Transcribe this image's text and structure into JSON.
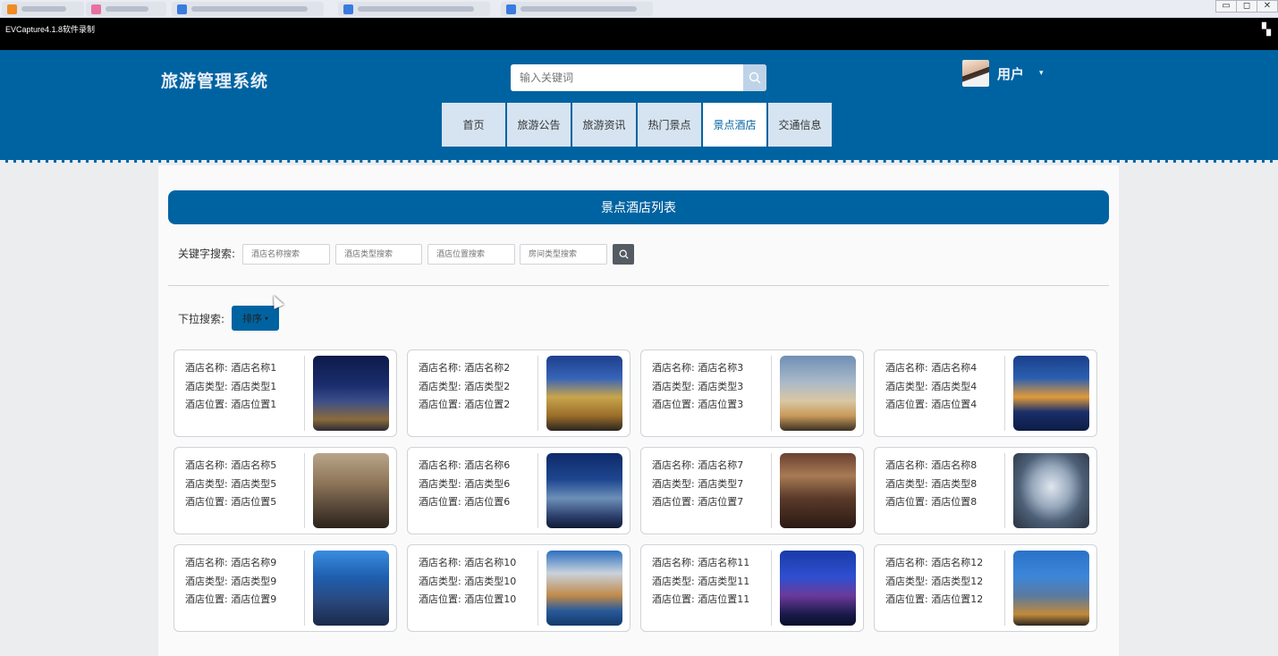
{
  "os": {
    "window_controls": [
      "▭",
      "◻",
      "✕"
    ]
  },
  "capture": {
    "title": "EVCapture4.1.8软件录制",
    "menu_icon": "grid-menu-icon"
  },
  "header": {
    "site_title": "旅游管理系统",
    "search_placeholder": "输入关键词",
    "user_name": "用户",
    "user_caret": "▾"
  },
  "nav": {
    "items": [
      "首页",
      "旅游公告",
      "旅游资讯",
      "热门景点",
      "景点酒店",
      "交通信息"
    ],
    "active": "景点酒店"
  },
  "panel": {
    "title": "景点酒店列表"
  },
  "filters": {
    "keyword_label": "关键字搜索:",
    "placeholders": [
      "酒店名称搜索",
      "酒店类型搜索",
      "酒店位置搜索",
      "房间类型搜索"
    ],
    "dropdown_label": "下拉搜索:",
    "sort_label": "排序",
    "sort_caret": "▾"
  },
  "hotels": [
    {
      "name": "酒店名称: 酒店名称1",
      "type": "酒店类型: 酒店类型1",
      "location": "酒店位置: 酒店位置1"
    },
    {
      "name": "酒店名称: 酒店名称2",
      "type": "酒店类型: 酒店类型2",
      "location": "酒店位置: 酒店位置2"
    },
    {
      "name": "酒店名称: 酒店名称3",
      "type": "酒店类型: 酒店类型3",
      "location": "酒店位置: 酒店位置3"
    },
    {
      "name": "酒店名称: 酒店名称4",
      "type": "酒店类型: 酒店类型4",
      "location": "酒店位置: 酒店位置4"
    },
    {
      "name": "酒店名称: 酒店名称5",
      "type": "酒店类型: 酒店类型5",
      "location": "酒店位置: 酒店位置5"
    },
    {
      "name": "酒店名称: 酒店名称6",
      "type": "酒店类型: 酒店类型6",
      "location": "酒店位置: 酒店位置6"
    },
    {
      "name": "酒店名称: 酒店名称7",
      "type": "酒店类型: 酒店类型7",
      "location": "酒店位置: 酒店位置7"
    },
    {
      "name": "酒店名称: 酒店名称8",
      "type": "酒店类型: 酒店类型8",
      "location": "酒店位置: 酒店位置8"
    },
    {
      "name": "酒店名称: 酒店名称9",
      "type": "酒店类型: 酒店类型9",
      "location": "酒店位置: 酒店位置9"
    },
    {
      "name": "酒店名称: 酒店名称10",
      "type": "酒店类型: 酒店类型10",
      "location": "酒店位置: 酒店位置10"
    },
    {
      "name": "酒店名称: 酒店名称11",
      "type": "酒店类型: 酒店类型11",
      "location": "酒店位置: 酒店位置11"
    },
    {
      "name": "酒店名称: 酒店名称12",
      "type": "酒店类型: 酒店类型12",
      "location": "酒店位置: 酒店位置12"
    }
  ],
  "colors": {
    "brand": "#0063a1",
    "nav_bg": "#d6e4f1"
  }
}
